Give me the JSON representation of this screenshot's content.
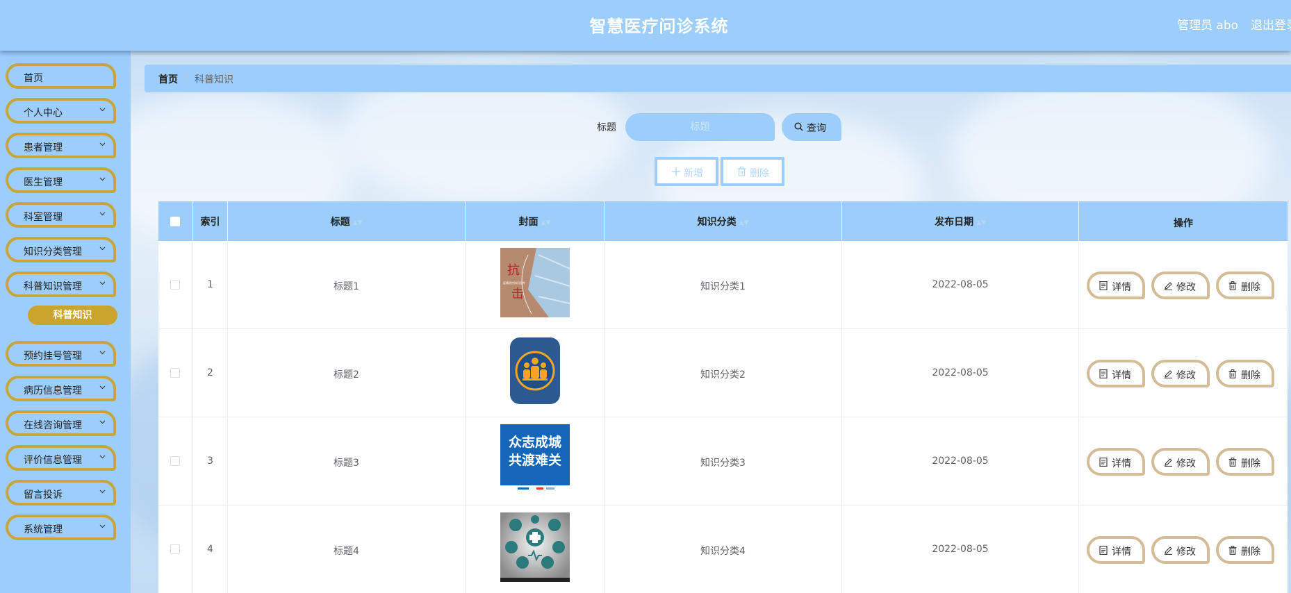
{
  "header": {
    "title": "智慧医疗问诊系统",
    "user": "管理员 abo",
    "logout": "退出登录"
  },
  "sidebar": {
    "items": [
      {
        "label": "首页",
        "has_children": false
      },
      {
        "label": "个人中心",
        "has_children": true
      },
      {
        "label": "患者管理",
        "has_children": true
      },
      {
        "label": "医生管理",
        "has_children": true
      },
      {
        "label": "科室管理",
        "has_children": true
      },
      {
        "label": "知识分类管理",
        "has_children": true
      },
      {
        "label": "科普知识管理",
        "has_children": true
      },
      {
        "label": "预约挂号管理",
        "has_children": true
      },
      {
        "label": "病历信息管理",
        "has_children": true
      },
      {
        "label": "在线咨询管理",
        "has_children": true
      },
      {
        "label": "评价信息管理",
        "has_children": true
      },
      {
        "label": "留言投诉",
        "has_children": true
      },
      {
        "label": "系统管理",
        "has_children": true
      }
    ],
    "active_sub": "科普知识"
  },
  "breadcrumb": {
    "home": "首页",
    "separator": "/",
    "current": "科普知识"
  },
  "search": {
    "label": "标题",
    "placeholder": "标题",
    "query_button": "查询"
  },
  "actions": {
    "add": "新增",
    "delete": "删除"
  },
  "table": {
    "columns": [
      "索引",
      "标题",
      "封面",
      "知识分类",
      "发布日期",
      "操作"
    ],
    "rows": [
      {
        "index": "1",
        "title": "标题1",
        "cover": "mask-poster",
        "category": "知识分类1",
        "date": "2022-08-05"
      },
      {
        "index": "2",
        "title": "标题2",
        "cover": "people-badge-icon",
        "category": "知识分类2",
        "date": "2022-08-05"
      },
      {
        "index": "3",
        "title": "标题3",
        "cover": "unity-poster",
        "category": "知识分类3",
        "date": "2022-08-05"
      },
      {
        "index": "4",
        "title": "标题4",
        "cover": "medical-icons-poster",
        "category": "知识分类4",
        "date": "2022-08-05"
      }
    ],
    "row_actions": {
      "detail": "详情",
      "edit": "修改",
      "delete": "删除"
    }
  },
  "covers": {
    "mask_poster_text": "抗击",
    "mask_poster_sub": "疫情防控知识宣传",
    "unity_poster_line1": "众志成城",
    "unity_poster_line2": "共渡难关"
  },
  "colors": {
    "primary": "#9ccdfb",
    "gold": "#c8a43c",
    "op_border": "#d4bc97"
  }
}
